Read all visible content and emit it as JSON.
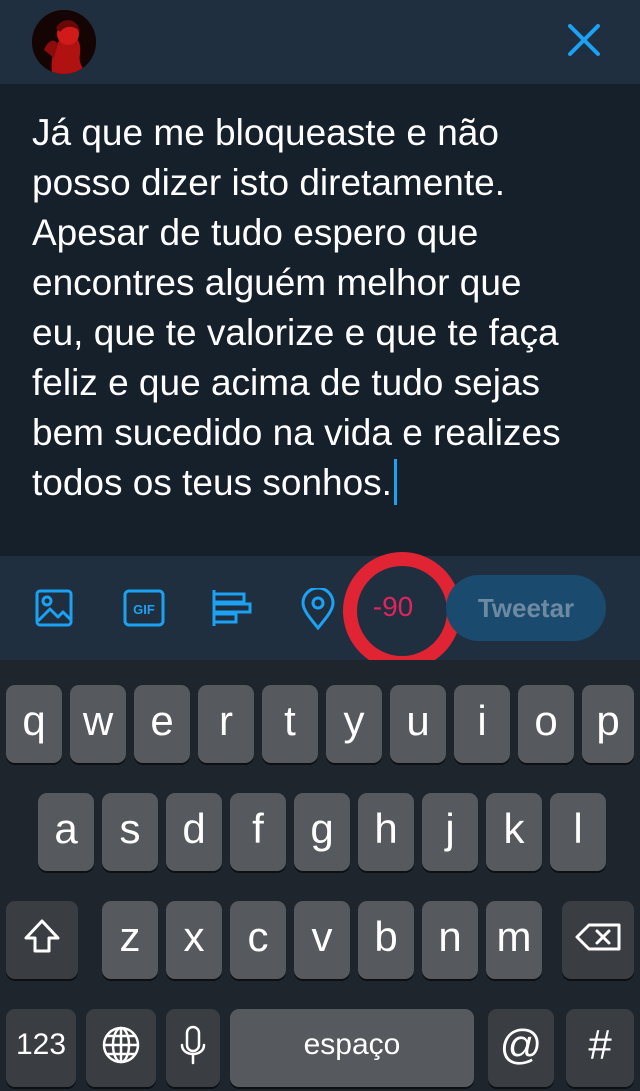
{
  "header": {
    "avatar_icon": "avatar",
    "close_icon": "close-icon"
  },
  "compose": {
    "text": "Já que me bloqueaste e não\nposso dizer isto diretamente.\nApesar de tudo espero que\nencontres alguém melhor que\neu, que te valorize e que te faça\nfeliz e que acima de tudo sejas\nbem sucedido na vida e realizes\ntodos os teus sonhos."
  },
  "toolbar": {
    "icons": [
      "image-icon",
      "gif-icon",
      "poll-icon",
      "location-icon"
    ],
    "gif_label": "GIF",
    "counter": "-90",
    "tweet_label": "Tweetar"
  },
  "keyboard": {
    "row1": [
      "q",
      "w",
      "e",
      "r",
      "t",
      "y",
      "u",
      "i",
      "o",
      "p"
    ],
    "row2": [
      "a",
      "s",
      "d",
      "f",
      "g",
      "h",
      "j",
      "k",
      "l"
    ],
    "row3": [
      "z",
      "x",
      "c",
      "v",
      "b",
      "n",
      "m"
    ],
    "numbers_label": "123",
    "space_label": "espaço",
    "at_label": "@",
    "hash_label": "#"
  },
  "colors": {
    "accent": "#1da1f2",
    "counter_over_limit": "#e0245e",
    "annotation_circle": "#e02434",
    "background": "#15202b"
  }
}
